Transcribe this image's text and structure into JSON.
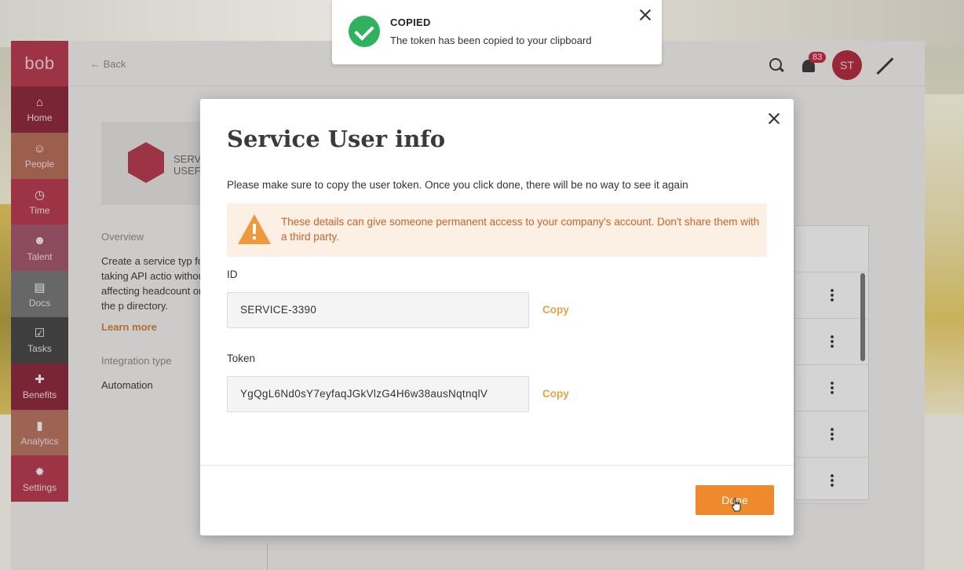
{
  "app": {
    "logo": "bob",
    "back_label": "← Back",
    "notifications_count": "83",
    "avatar_initials": "ST"
  },
  "sidebar": {
    "items": [
      {
        "label": "Home",
        "icon": "home-icon",
        "color": "#8c1f35"
      },
      {
        "label": "People",
        "icon": "people-icon",
        "color": "#b96a52"
      },
      {
        "label": "Time",
        "icon": "clock-icon",
        "color": "#b8334a"
      },
      {
        "label": "Talent",
        "icon": "talent-icon",
        "color": "#a3506a"
      },
      {
        "label": "Docs",
        "icon": "document-icon",
        "color": "#747474"
      },
      {
        "label": "Tasks",
        "icon": "tasks-icon",
        "color": "#3f3f3f"
      },
      {
        "label": "Benefits",
        "icon": "gift-icon",
        "color": "#8c1f35"
      },
      {
        "label": "Analytics",
        "icon": "chart-icon",
        "color": "#b9705a"
      },
      {
        "label": "Settings",
        "icon": "gear-icon",
        "color": "#b8334a"
      }
    ]
  },
  "left_panel": {
    "card_title_line1": "SERV",
    "card_title_line2": "USEF",
    "overview_label": "Overview",
    "overview_text": "Create a service typ for taking API actio without affecting headcount or the p directory.",
    "learn_more": "Learn more",
    "integration_label": "Integration type",
    "integration_value": "Automation"
  },
  "toast": {
    "title": "COPIED",
    "message": "The token has been copied to your clipboard"
  },
  "modal": {
    "title": "Service User info",
    "intro": "Please make sure to copy the user token. Once you click done, there will be no way to see it again",
    "warning": "These details can give someone permanent access to your company's account. Don't share them with a third party.",
    "id_label": "ID",
    "id_value": "SERVICE-3390",
    "token_label": "Token",
    "token_value": "YgQgL6Nd0sY7eyfaqJGkVlzG4H6w38ausNqtnqlV",
    "copy_label": "Copy",
    "done_label": "Done"
  },
  "colors": {
    "brand": "#b8334a",
    "accent_orange": "#ee8a2c",
    "success_green": "#30b160",
    "warning_bg": "#fcefe4",
    "warning_text": "#c8652a"
  }
}
